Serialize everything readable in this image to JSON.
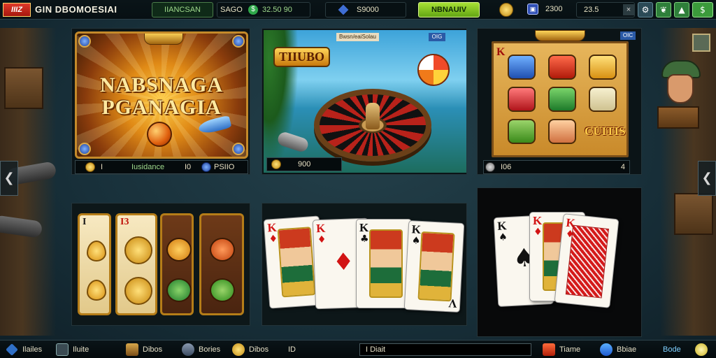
{
  "topbar": {
    "logo_text": "IIIZ",
    "site_name": "GIN DBOMOESIAI",
    "tab_label": "IIANCSAN",
    "stat_label": "SAGO",
    "stat_value": "32.50 90",
    "gem_value": "S9000",
    "cta_label": "NBNAUIV",
    "badge_value": "2300",
    "balance_value": "23.5",
    "close_label": "×",
    "icon_buttons": [
      "gear-icon",
      "leaf-icon",
      "up-arrow-icon",
      "money-icon"
    ]
  },
  "nav": {
    "prev": "❮",
    "next": "❮"
  },
  "games": [
    {
      "title_line1": "NABSNAGA",
      "title_line2": "PGANAGIA",
      "bar_label": "Iusidance",
      "bar_mid": "I0",
      "bar_value": "PSIIO",
      "bar_prefix": "I"
    },
    {
      "header": "Bwsn/eaiSolau",
      "badge": "OIG",
      "logo": "TIIUBO",
      "bar_value": "900"
    },
    {
      "badge": "OIC",
      "rank": "K",
      "wordmark": "CUITIS",
      "bar_value": "I06",
      "bar_suffix": "4"
    }
  ],
  "slot_cards": [
    {
      "rank": "I",
      "kind": "drops"
    },
    {
      "rank": "I3",
      "kind": "coins"
    },
    {
      "rank": "",
      "kind": "fruit-orange"
    },
    {
      "rank": "",
      "kind": "fruit-red"
    }
  ],
  "poker_hand": [
    {
      "rank": "K",
      "suit": "♦",
      "color": "#d21414"
    },
    {
      "rank": "K",
      "suit": "♦",
      "color": "#d21414"
    },
    {
      "rank": "K",
      "suit": "♣",
      "color": "#111111"
    },
    {
      "rank": "V",
      "suit": "♠",
      "color": "#111111"
    }
  ],
  "blackjack_hand": [
    {
      "rank": "K",
      "suit": "♠",
      "color": "#111111"
    },
    {
      "rank": "K",
      "suit": "♦",
      "color": "#d21414"
    },
    {
      "rank": "K",
      "suit": "♦",
      "color": "#d21414"
    }
  ],
  "bottombar": {
    "items": [
      {
        "label": "Ilailes",
        "icon": "diamond-icon"
      },
      {
        "label": "Iluite",
        "icon": "grid-icon"
      },
      {
        "label": "Dibos",
        "icon": "chest-icon"
      },
      {
        "label": "Bories",
        "icon": "crown-icon"
      },
      {
        "label": "Dibos",
        "icon": "coin-icon"
      },
      {
        "label": "ID",
        "icon": ""
      }
    ],
    "field_text": "I Diait",
    "right_items": [
      {
        "label": "Tiame",
        "icon": "gift-icon"
      },
      {
        "label": "Bbiae",
        "icon": "heart-icon"
      },
      {
        "label": "Bode",
        "icon": "coin-icon"
      }
    ]
  }
}
